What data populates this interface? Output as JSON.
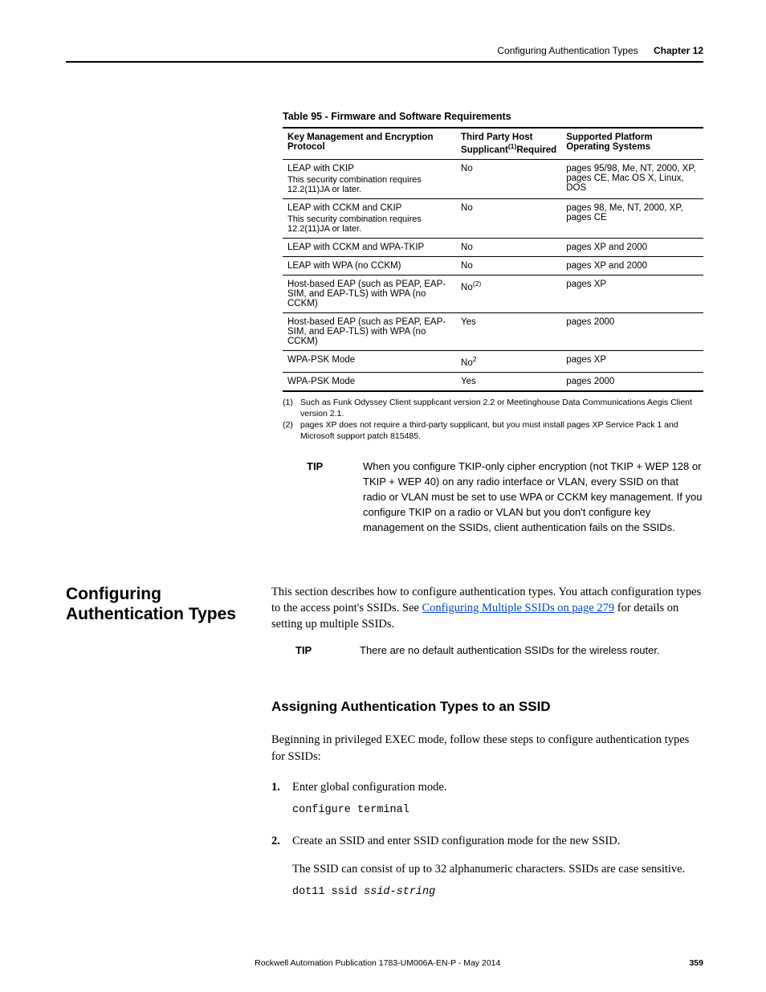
{
  "header": {
    "section": "Configuring Authentication Types",
    "chapter": "Chapter 12"
  },
  "table": {
    "caption": "Table 95 - Firmware and Software Requirements",
    "columns": {
      "c0": "Key Management and Encryption Protocol",
      "c1_pre": "Third Party Host Supplicant",
      "c1_sup": "(1)",
      "c1_post": "Required",
      "c2": "Supported Platform Operating Systems"
    },
    "rows": [
      {
        "protocol": "LEAP with CKIP",
        "note": "This security combination requires 12.2(11)JA or later.",
        "supplicant": "No",
        "platforms": "pages 95/98, Me, NT, 2000, XP, pages CE, Mac OS X, Linux, DOS"
      },
      {
        "protocol": "LEAP with CCKM and CKIP",
        "note": "This security combination requires 12.2(11)JA or later.",
        "supplicant": "No",
        "platforms": "pages 98, Me, NT, 2000, XP, pages CE"
      },
      {
        "protocol": "LEAP with CCKM and WPA-TKIP",
        "note": "",
        "supplicant": "No",
        "platforms": "pages XP and 2000"
      },
      {
        "protocol": "LEAP with WPA (no CCKM)",
        "note": "",
        "supplicant": "No",
        "platforms": "pages XP and 2000"
      },
      {
        "protocol": "Host-based EAP (such as PEAP, EAP-SIM, and EAP-TLS) with WPA (no CCKM)",
        "note": "",
        "supplicant": "No",
        "sup": "(2)",
        "platforms": "pages XP"
      },
      {
        "protocol": "Host-based EAP (such as PEAP, EAP-SIM, and EAP-TLS) with WPA (no CCKM)",
        "note": "",
        "supplicant": "Yes",
        "platforms": "pages 2000"
      },
      {
        "protocol": "WPA-PSK Mode",
        "note": "",
        "supplicant": "No",
        "sup": "2",
        "platforms": "pages XP"
      },
      {
        "protocol": "WPA-PSK Mode",
        "note": "",
        "supplicant": "Yes",
        "platforms": "pages 2000"
      }
    ]
  },
  "footnotes": [
    {
      "n": "(1)",
      "t": "Such as Funk Odyssey Client supplicant version 2.2 or Meetinghouse Data Communications Aegis Client version 2.1."
    },
    {
      "n": "(2)",
      "t": "pages XP does not require a third-party supplicant, but you must install pages XP Service Pack 1 and Microsoft support patch 815485."
    }
  ],
  "tip1": {
    "label": "TIP",
    "text": "When you configure TKIP-only cipher encryption (not TKIP + WEP 128 or TKIP + WEP 40) on any radio interface or VLAN, every SSID on that radio or VLAN must be set to use WPA or CCKM key management. If you configure TKIP on a radio or VLAN but you don't configure key management on the SSIDs, client authentication fails on the SSIDs."
  },
  "section": {
    "heading": "Configuring Authentication Types",
    "intro_pre": "This section describes how to configure authentication types. You attach configuration types to the access point's SSIDs. See ",
    "link": "Configuring Multiple SSIDs on page 279",
    "intro_post": " for details on setting up multiple SSIDs."
  },
  "tip2": {
    "label": "TIP",
    "text": "There are no default authentication SSIDs for the wireless router."
  },
  "subsection": {
    "heading": "Assigning Authentication Types to an SSID",
    "lead": "Beginning in privileged EXEC mode, follow these steps to configure authentication types for SSIDs:",
    "steps": [
      {
        "n": "1.",
        "text": "Enter global configuration mode.",
        "code": "configure terminal"
      },
      {
        "n": "2.",
        "text": "Create an SSID and enter SSID configuration mode for the new SSID.",
        "p2": "The SSID can consist of up to 32 alphanumeric characters. SSIDs are case sensitive.",
        "code_pre": "dot11 ssid ",
        "code_em": "ssid-string"
      }
    ]
  },
  "footer": {
    "pub": "Rockwell Automation Publication 1783-UM006A-EN-P - May 2014",
    "page": "359"
  }
}
